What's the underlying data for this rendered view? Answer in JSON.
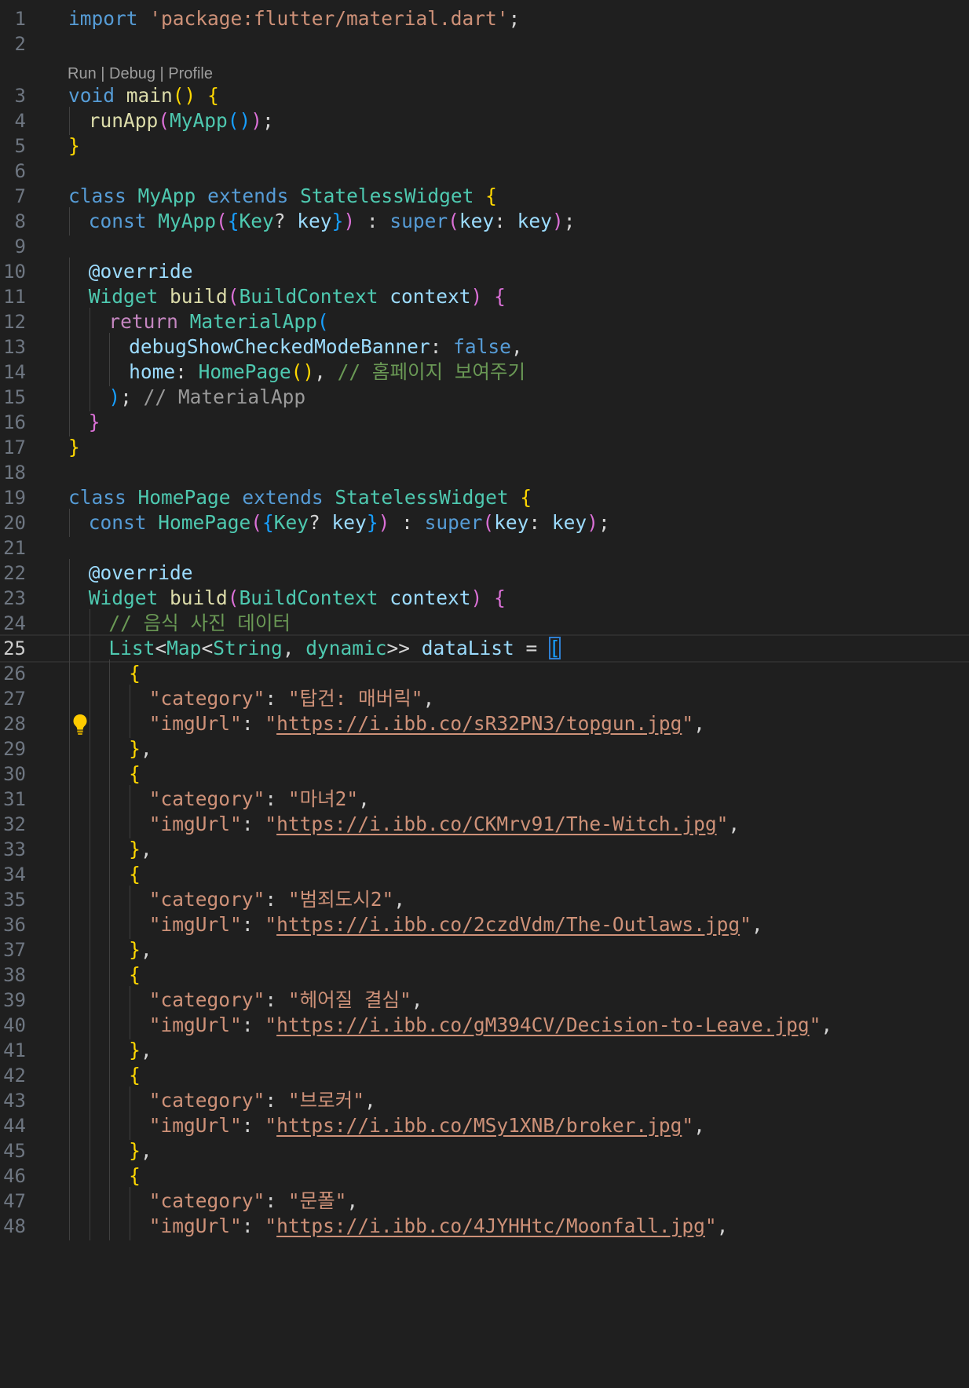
{
  "editor": {
    "codelens": {
      "run": "Run",
      "debug": "Debug",
      "profile": "Profile",
      "separator": " | "
    },
    "current_line": "25",
    "lines": [
      {
        "n": "1",
        "tokens": [
          {
            "c": "k",
            "t": "import"
          },
          {
            "c": "w",
            "t": " "
          },
          {
            "c": "s",
            "t": "'package:flutter/material.dart'"
          },
          {
            "c": "w",
            "t": ";"
          }
        ]
      },
      {
        "n": "2",
        "tokens": []
      },
      {
        "n": "3",
        "tokens": [
          {
            "c": "k",
            "t": "void"
          },
          {
            "c": "w",
            "t": " "
          },
          {
            "c": "f",
            "t": "main"
          },
          {
            "c": "y",
            "t": "()"
          },
          {
            "c": "w",
            "t": " "
          },
          {
            "c": "y",
            "t": "{"
          }
        ]
      },
      {
        "n": "4",
        "tokens": [
          {
            "c": "f",
            "t": "runApp"
          },
          {
            "c": "p",
            "t": "("
          },
          {
            "c": "t",
            "t": "MyApp"
          },
          {
            "c": "b",
            "t": "()"
          },
          {
            "c": "p",
            "t": ")"
          },
          {
            "c": "w",
            "t": ";"
          }
        ]
      },
      {
        "n": "5",
        "tokens": [
          {
            "c": "y",
            "t": "}"
          }
        ]
      },
      {
        "n": "6",
        "tokens": []
      },
      {
        "n": "7",
        "tokens": [
          {
            "c": "k",
            "t": "class"
          },
          {
            "c": "w",
            "t": " "
          },
          {
            "c": "t",
            "t": "MyApp"
          },
          {
            "c": "w",
            "t": " "
          },
          {
            "c": "k",
            "t": "extends"
          },
          {
            "c": "w",
            "t": " "
          },
          {
            "c": "t",
            "t": "StatelessWidget"
          },
          {
            "c": "w",
            "t": " "
          },
          {
            "c": "y",
            "t": "{"
          }
        ]
      },
      {
        "n": "8",
        "tokens": [
          {
            "c": "k",
            "t": "const"
          },
          {
            "c": "w",
            "t": " "
          },
          {
            "c": "t",
            "t": "MyApp"
          },
          {
            "c": "p",
            "t": "("
          },
          {
            "c": "b",
            "t": "{"
          },
          {
            "c": "t",
            "t": "Key"
          },
          {
            "c": "w",
            "t": "? "
          },
          {
            "c": "v",
            "t": "key"
          },
          {
            "c": "b",
            "t": "}"
          },
          {
            "c": "p",
            "t": ")"
          },
          {
            "c": "w",
            "t": " : "
          },
          {
            "c": "k",
            "t": "super"
          },
          {
            "c": "p",
            "t": "("
          },
          {
            "c": "v",
            "t": "key"
          },
          {
            "c": "w",
            "t": ": "
          },
          {
            "c": "v",
            "t": "key"
          },
          {
            "c": "p",
            "t": ")"
          },
          {
            "c": "w",
            "t": ";"
          }
        ]
      },
      {
        "n": "9",
        "tokens": []
      },
      {
        "n": "10",
        "tokens": [
          {
            "c": "v",
            "t": "@override"
          }
        ]
      },
      {
        "n": "11",
        "tokens": [
          {
            "c": "t",
            "t": "Widget"
          },
          {
            "c": "w",
            "t": " "
          },
          {
            "c": "f",
            "t": "build"
          },
          {
            "c": "p",
            "t": "("
          },
          {
            "c": "t",
            "t": "BuildContext"
          },
          {
            "c": "w",
            "t": " "
          },
          {
            "c": "v",
            "t": "context"
          },
          {
            "c": "p",
            "t": ")"
          },
          {
            "c": "w",
            "t": " "
          },
          {
            "c": "p",
            "t": "{"
          }
        ]
      },
      {
        "n": "12",
        "tokens": [
          {
            "c": "kc",
            "t": "return"
          },
          {
            "c": "w",
            "t": " "
          },
          {
            "c": "t",
            "t": "MaterialApp"
          },
          {
            "c": "b",
            "t": "("
          }
        ]
      },
      {
        "n": "13",
        "tokens": [
          {
            "c": "v",
            "t": "debugShowCheckedModeBanner"
          },
          {
            "c": "w",
            "t": ": "
          },
          {
            "c": "k",
            "t": "false"
          },
          {
            "c": "w",
            "t": ","
          }
        ]
      },
      {
        "n": "14",
        "tokens": [
          {
            "c": "v",
            "t": "home"
          },
          {
            "c": "w",
            "t": ": "
          },
          {
            "c": "t",
            "t": "HomePage"
          },
          {
            "c": "y",
            "t": "()"
          },
          {
            "c": "w",
            "t": ", "
          },
          {
            "c": "c",
            "t": "// 홈페이지 보여주기"
          }
        ]
      },
      {
        "n": "15",
        "tokens": [
          {
            "c": "b",
            "t": ")"
          },
          {
            "c": "w",
            "t": "; "
          },
          {
            "c": "cg",
            "t": "// MaterialApp"
          }
        ]
      },
      {
        "n": "16",
        "tokens": [
          {
            "c": "p",
            "t": "}"
          }
        ]
      },
      {
        "n": "17",
        "tokens": [
          {
            "c": "y",
            "t": "}"
          }
        ]
      },
      {
        "n": "18",
        "tokens": []
      },
      {
        "n": "19",
        "tokens": [
          {
            "c": "k",
            "t": "class"
          },
          {
            "c": "w",
            "t": " "
          },
          {
            "c": "t",
            "t": "HomePage"
          },
          {
            "c": "w",
            "t": " "
          },
          {
            "c": "k",
            "t": "extends"
          },
          {
            "c": "w",
            "t": " "
          },
          {
            "c": "t",
            "t": "StatelessWidget"
          },
          {
            "c": "w",
            "t": " "
          },
          {
            "c": "y",
            "t": "{"
          }
        ]
      },
      {
        "n": "20",
        "tokens": [
          {
            "c": "k",
            "t": "const"
          },
          {
            "c": "w",
            "t": " "
          },
          {
            "c": "t",
            "t": "HomePage"
          },
          {
            "c": "p",
            "t": "("
          },
          {
            "c": "b",
            "t": "{"
          },
          {
            "c": "t",
            "t": "Key"
          },
          {
            "c": "w",
            "t": "? "
          },
          {
            "c": "v",
            "t": "key"
          },
          {
            "c": "b",
            "t": "}"
          },
          {
            "c": "p",
            "t": ")"
          },
          {
            "c": "w",
            "t": " : "
          },
          {
            "c": "k",
            "t": "super"
          },
          {
            "c": "p",
            "t": "("
          },
          {
            "c": "v",
            "t": "key"
          },
          {
            "c": "w",
            "t": ": "
          },
          {
            "c": "v",
            "t": "key"
          },
          {
            "c": "p",
            "t": ")"
          },
          {
            "c": "w",
            "t": ";"
          }
        ]
      },
      {
        "n": "21",
        "tokens": []
      },
      {
        "n": "22",
        "tokens": [
          {
            "c": "v",
            "t": "@override"
          }
        ]
      },
      {
        "n": "23",
        "tokens": [
          {
            "c": "t",
            "t": "Widget"
          },
          {
            "c": "w",
            "t": " "
          },
          {
            "c": "f",
            "t": "build"
          },
          {
            "c": "p",
            "t": "("
          },
          {
            "c": "t",
            "t": "BuildContext"
          },
          {
            "c": "w",
            "t": " "
          },
          {
            "c": "v",
            "t": "context"
          },
          {
            "c": "p",
            "t": ")"
          },
          {
            "c": "w",
            "t": " "
          },
          {
            "c": "p",
            "t": "{"
          }
        ]
      },
      {
        "n": "24",
        "tokens": [
          {
            "c": "c",
            "t": "// 음식 사진 데이터"
          }
        ]
      },
      {
        "n": "25",
        "tokens": [
          {
            "c": "t",
            "t": "List"
          },
          {
            "c": "w",
            "t": "<"
          },
          {
            "c": "t",
            "t": "Map"
          },
          {
            "c": "w",
            "t": "<"
          },
          {
            "c": "t",
            "t": "String"
          },
          {
            "c": "w",
            "t": ", "
          },
          {
            "c": "t",
            "t": "dynamic"
          },
          {
            "c": "w",
            "t": ">> "
          },
          {
            "c": "v",
            "t": "dataList"
          },
          {
            "c": "w",
            "t": " = "
          },
          {
            "c": "b",
            "t": "[",
            "cursor": true
          }
        ]
      },
      {
        "n": "26",
        "tokens": [
          {
            "c": "y",
            "t": "{"
          }
        ]
      },
      {
        "n": "27",
        "tokens": [
          {
            "c": "s",
            "t": "\"category\""
          },
          {
            "c": "w",
            "t": ": "
          },
          {
            "c": "s",
            "t": "\"탑건: 매버릭\""
          },
          {
            "c": "w",
            "t": ","
          }
        ]
      },
      {
        "n": "28",
        "tokens": [
          {
            "c": "s",
            "t": "\"imgUrl\""
          },
          {
            "c": "w",
            "t": ": "
          },
          {
            "c": "s",
            "t": "\""
          },
          {
            "c": "u",
            "t": "https://i.ibb.co/sR32PN3/topgun.jpg"
          },
          {
            "c": "s",
            "t": "\""
          },
          {
            "c": "w",
            "t": ","
          }
        ]
      },
      {
        "n": "29",
        "tokens": [
          {
            "c": "y",
            "t": "}"
          },
          {
            "c": "w",
            "t": ","
          }
        ]
      },
      {
        "n": "30",
        "tokens": [
          {
            "c": "y",
            "t": "{"
          }
        ]
      },
      {
        "n": "31",
        "tokens": [
          {
            "c": "s",
            "t": "\"category\""
          },
          {
            "c": "w",
            "t": ": "
          },
          {
            "c": "s",
            "t": "\"마녀2\""
          },
          {
            "c": "w",
            "t": ","
          }
        ]
      },
      {
        "n": "32",
        "tokens": [
          {
            "c": "s",
            "t": "\"imgUrl\""
          },
          {
            "c": "w",
            "t": ": "
          },
          {
            "c": "s",
            "t": "\""
          },
          {
            "c": "u",
            "t": "https://i.ibb.co/CKMrv91/The-Witch.jpg"
          },
          {
            "c": "s",
            "t": "\""
          },
          {
            "c": "w",
            "t": ","
          }
        ]
      },
      {
        "n": "33",
        "tokens": [
          {
            "c": "y",
            "t": "}"
          },
          {
            "c": "w",
            "t": ","
          }
        ]
      },
      {
        "n": "34",
        "tokens": [
          {
            "c": "y",
            "t": "{"
          }
        ]
      },
      {
        "n": "35",
        "tokens": [
          {
            "c": "s",
            "t": "\"category\""
          },
          {
            "c": "w",
            "t": ": "
          },
          {
            "c": "s",
            "t": "\"범죄도시2\""
          },
          {
            "c": "w",
            "t": ","
          }
        ]
      },
      {
        "n": "36",
        "tokens": [
          {
            "c": "s",
            "t": "\"imgUrl\""
          },
          {
            "c": "w",
            "t": ": "
          },
          {
            "c": "s",
            "t": "\""
          },
          {
            "c": "u",
            "t": "https://i.ibb.co/2czdVdm/The-Outlaws.jpg"
          },
          {
            "c": "s",
            "t": "\""
          },
          {
            "c": "w",
            "t": ","
          }
        ]
      },
      {
        "n": "37",
        "tokens": [
          {
            "c": "y",
            "t": "}"
          },
          {
            "c": "w",
            "t": ","
          }
        ]
      },
      {
        "n": "38",
        "tokens": [
          {
            "c": "y",
            "t": "{"
          }
        ]
      },
      {
        "n": "39",
        "tokens": [
          {
            "c": "s",
            "t": "\"category\""
          },
          {
            "c": "w",
            "t": ": "
          },
          {
            "c": "s",
            "t": "\"헤어질 결심\""
          },
          {
            "c": "w",
            "t": ","
          }
        ]
      },
      {
        "n": "40",
        "tokens": [
          {
            "c": "s",
            "t": "\"imgUrl\""
          },
          {
            "c": "w",
            "t": ": "
          },
          {
            "c": "s",
            "t": "\""
          },
          {
            "c": "u",
            "t": "https://i.ibb.co/gM394CV/Decision-to-Leave.jpg"
          },
          {
            "c": "s",
            "t": "\""
          },
          {
            "c": "w",
            "t": ","
          }
        ]
      },
      {
        "n": "41",
        "tokens": [
          {
            "c": "y",
            "t": "}"
          },
          {
            "c": "w",
            "t": ","
          }
        ]
      },
      {
        "n": "42",
        "tokens": [
          {
            "c": "y",
            "t": "{"
          }
        ]
      },
      {
        "n": "43",
        "tokens": [
          {
            "c": "s",
            "t": "\"category\""
          },
          {
            "c": "w",
            "t": ": "
          },
          {
            "c": "s",
            "t": "\"브로커\""
          },
          {
            "c": "w",
            "t": ","
          }
        ]
      },
      {
        "n": "44",
        "tokens": [
          {
            "c": "s",
            "t": "\"imgUrl\""
          },
          {
            "c": "w",
            "t": ": "
          },
          {
            "c": "s",
            "t": "\""
          },
          {
            "c": "u",
            "t": "https://i.ibb.co/MSy1XNB/broker.jpg"
          },
          {
            "c": "s",
            "t": "\""
          },
          {
            "c": "w",
            "t": ","
          }
        ]
      },
      {
        "n": "45",
        "tokens": [
          {
            "c": "y",
            "t": "}"
          },
          {
            "c": "w",
            "t": ","
          }
        ]
      },
      {
        "n": "46",
        "tokens": [
          {
            "c": "y",
            "t": "{"
          }
        ]
      },
      {
        "n": "47",
        "tokens": [
          {
            "c": "s",
            "t": "\"category\""
          },
          {
            "c": "w",
            "t": ": "
          },
          {
            "c": "s",
            "t": "\"문폴\""
          },
          {
            "c": "w",
            "t": ","
          }
        ]
      },
      {
        "n": "48",
        "tokens": [
          {
            "c": "s",
            "t": "\"imgUrl\""
          },
          {
            "c": "w",
            "t": ": "
          },
          {
            "c": "s",
            "t": "\""
          },
          {
            "c": "u",
            "t": "https://i.ibb.co/4JYHHtc/Moonfall.jpg"
          },
          {
            "c": "s",
            "t": "\""
          },
          {
            "c": "w",
            "t": ","
          }
        ]
      }
    ]
  }
}
